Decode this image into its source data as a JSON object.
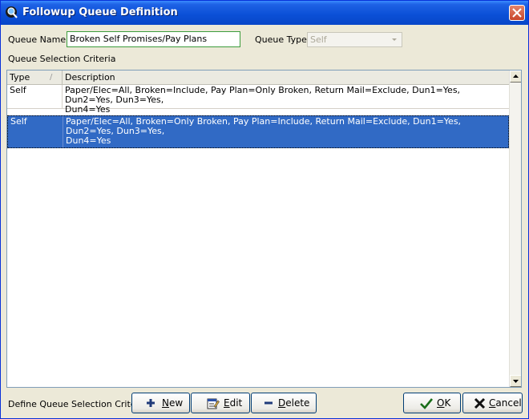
{
  "window": {
    "title": "Followup Queue Definition",
    "icon": "queue-search-icon",
    "close_icon": "close-x-icon"
  },
  "queue_name": {
    "label": "Queue Name",
    "value": "Broken Self Promises/Pay Plans"
  },
  "queue_type": {
    "label": "Queue Type",
    "value": "Self"
  },
  "criteria": {
    "section_label": "Queue Selection Criteria",
    "columns": [
      "Type",
      "Description"
    ],
    "sort_indicator": "/",
    "rows": [
      {
        "type": "Self",
        "description_line1": "Paper/Elec=All, Broken=Include, Pay Plan=Only Broken, Return Mail=Exclude, Dun1=Yes, Dun2=Yes, Dun3=Yes,",
        "description_line2": "Dun4=Yes"
      },
      {
        "type": "Self",
        "description_line1": "Paper/Elec=All, Broken=Only Broken, Pay Plan=Include, Return Mail=Exclude, Dun1=Yes, Dun2=Yes, Dun3=Yes,",
        "description_line2": "Dun4=Yes"
      }
    ],
    "selected_row": 1
  },
  "footer": {
    "define_label": "Define Queue Selection Criteria",
    "new": {
      "key": "N",
      "rest": "ew",
      "icon": "plus-icon"
    },
    "edit": {
      "key": "E",
      "rest": "dit",
      "icon": "edit-document-icon"
    },
    "delete": {
      "key": "D",
      "rest": "elete",
      "icon": "minus-icon"
    },
    "ok": {
      "key": "O",
      "rest": "K",
      "icon": "checkmark-icon"
    },
    "cancel": {
      "key": "C",
      "rest": "ancel",
      "icon": "x-cancel-icon"
    }
  },
  "colors": {
    "selection": "#316AC5",
    "titlebar": "#0A4FD6",
    "queue_name_border": "#3C9C3C"
  }
}
